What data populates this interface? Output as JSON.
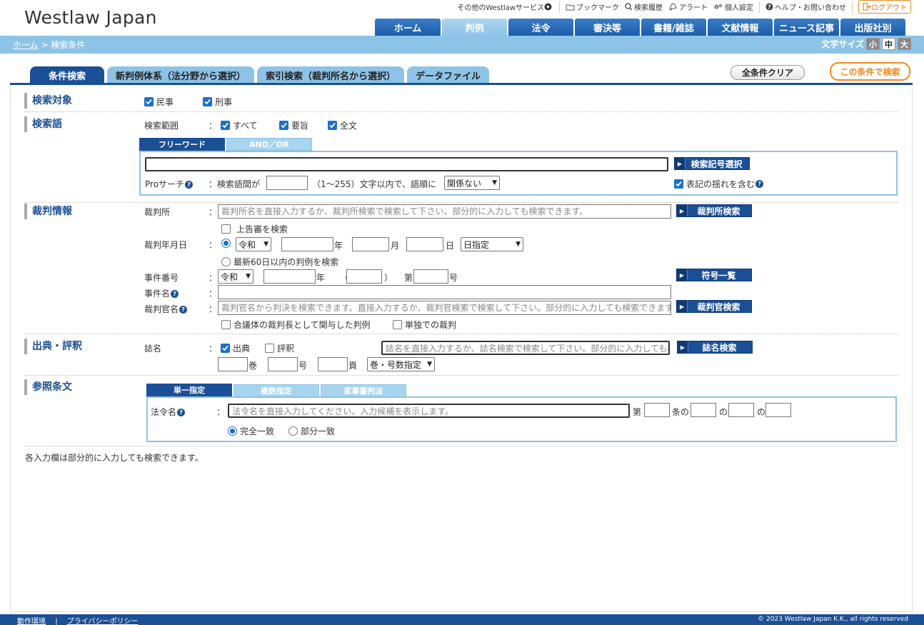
{
  "header": {
    "logo": "Westlaw Japan",
    "utility": {
      "other_services": "その他のWestlawサービス",
      "bookmark": "ブックマーク",
      "history": "検索履歴",
      "alert": "アラート",
      "settings": "個人設定",
      "help": "ヘルプ・お問い合わせ",
      "logout": "ログアウト"
    },
    "nav_tabs": [
      "ホーム",
      "判例",
      "法令",
      "審決等",
      "書籍/雑誌",
      "文献情報",
      "ニュース記事",
      "出版社別"
    ],
    "active_nav": "判例"
  },
  "breadcrumb": {
    "home": "ホーム",
    "separator": " > ",
    "current": "検索条件"
  },
  "font_size": {
    "label": "文字サイズ",
    "small": "小",
    "medium": "中",
    "large": "大",
    "selected": "中"
  },
  "search_tabs": [
    "条件検索",
    "新判例体系（法分野から選択）",
    "索引検索（裁判所名から選択）",
    "データファイル"
  ],
  "actions": {
    "clear_all": "全条件クリア",
    "search": "この条件で検索"
  },
  "sections": {
    "target": {
      "label": "検索対象",
      "civil": "民事",
      "criminal": "刑事"
    },
    "keyword": {
      "label": "検索語",
      "range_label": "検索範囲",
      "colon": "：",
      "all": "すべて",
      "summary": "要旨",
      "fulltext": "全文",
      "tab_free": "フリーワード",
      "tab_andor": "AND／OR",
      "symbol_btn": "検索記号選択",
      "pro_label": "Proサーチ",
      "pro_text1": "検索語間が",
      "pro_text2": "（1～255）文字以内で、語順に",
      "order_select": "関係ない",
      "variant": "表記の揺れを含む"
    },
    "trial": {
      "label": "裁判情報",
      "court_label": "裁判所",
      "court_placeholder": "裁判所名を直接入力するか、裁判所検索で検索して下さい。部分的に入力しても検索できます。",
      "court_btn": "裁判所検索",
      "appeal": "上告審を検索",
      "date_label": "裁判年月日",
      "era": "令和",
      "year": "年",
      "month": "月",
      "day": "日",
      "day_select": "日指定",
      "recent": "最新60日以内の判例を検索",
      "case_no_label": "事件番号",
      "case_era": "令和",
      "case_year": "年",
      "open_paren": "（",
      "close_paren": "）",
      "dai": "第",
      "go": "号",
      "code_btn": "符号一覧",
      "case_name_label": "事件名",
      "judge_label": "裁判官名",
      "judge_placeholder": "裁判官名から判決を検索できます。直接入力するか、裁判官検索で検索して下さい。部分的に入力しても検索できます。",
      "judge_btn": "裁判官検索",
      "presiding": "合議体の裁判長として関与した判例",
      "single": "単独での裁判"
    },
    "source": {
      "label": "出典・評釈",
      "journal_label": "誌名",
      "shutten": "出典",
      "hyoshaku": "評釈",
      "journal_placeholder": "誌名を直接入力するか、誌名検索で検索して下さい。部分的に入力しても検索できます。",
      "journal_btn": "誌名検索",
      "volume": "巻",
      "number": "号",
      "page": "頁",
      "vol_select": "巻・号数指定"
    },
    "reference": {
      "label": "参照条文",
      "tab_single": "単一指定",
      "tab_multi": "複数指定",
      "tab_family": "家事審判法",
      "law_label": "法令名",
      "law_placeholder": "法令名を直接入力してください。入力候補を表示します。",
      "dai": "第",
      "jo_no": "条の",
      "no1": "の",
      "no2": "の",
      "exact": "完全一致",
      "partial": "部分一致"
    }
  },
  "note": "各入力欄は部分的に入力しても検索できます。",
  "footer": {
    "env": "動作環境",
    "sep": "|",
    "privacy": "プライバシーポリシー",
    "copyright": "© 2023 Westlaw Japan K.K., all rights reserved"
  },
  "colors": {
    "navy": "#1b4f96",
    "light_blue": "#8dc3e6",
    "orange": "#f08a1e",
    "check_blue": "#1b6fd0"
  }
}
